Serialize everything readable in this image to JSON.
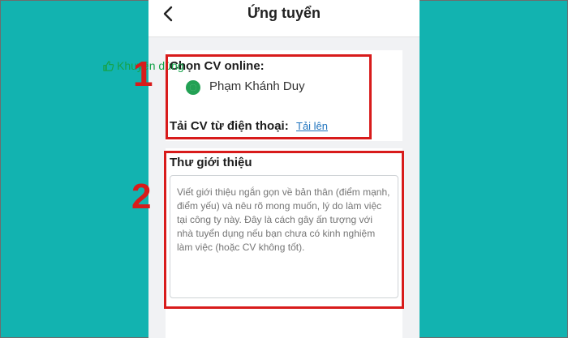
{
  "header": {
    "title": "Ứng tuyển"
  },
  "online_cv": {
    "label": "Chọn CV online:",
    "badge": "Khuyên dùng",
    "selected_cv": "Phạm Khánh Duy"
  },
  "upload": {
    "label": "Tải CV từ điện thoại:",
    "link": "Tải lên"
  },
  "cover_letter": {
    "label": "Thư giới thiệu",
    "placeholder": "Viết giới thiệu ngắn gọn về bản thân (điểm mạnh, điểm yếu) và nêu rõ mong muốn, lý do làm việc tại công ty này. Đây là cách gây ấn tượng với nhà tuyển dụng nếu bạn chưa có kinh nghiệm làm việc (hoặc CV không tốt)."
  },
  "annotations": {
    "step1": "1",
    "step2": "2"
  },
  "colors": {
    "background": "#12b3b0",
    "highlight": "#d81b1b",
    "accent_green": "#16a34a",
    "link_blue": "#1e73be"
  }
}
